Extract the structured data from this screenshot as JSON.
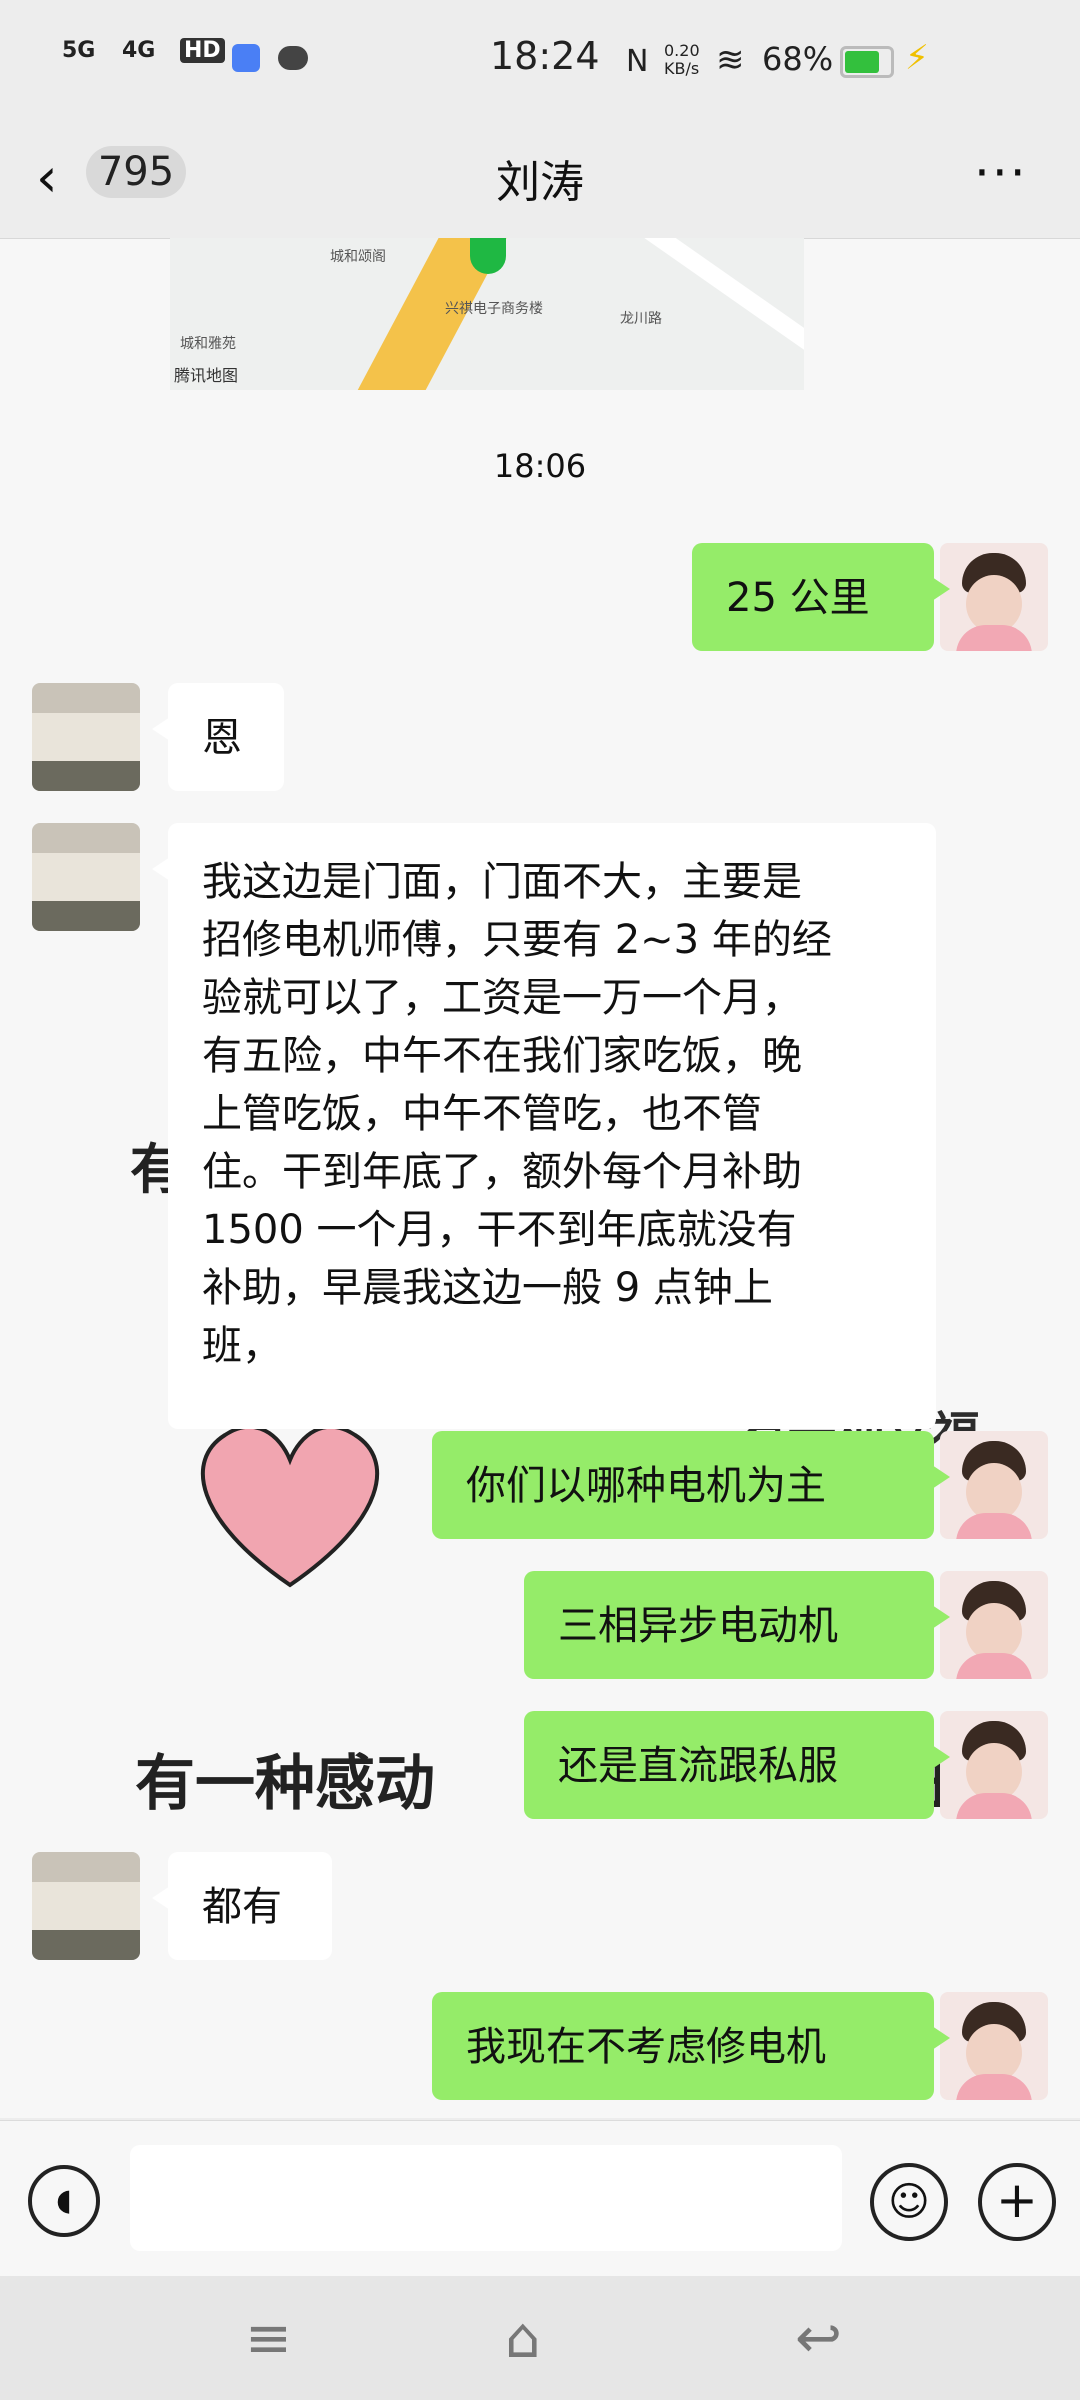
{
  "status_bar": {
    "signal_1": "5G",
    "signal_2": "4G",
    "hd": "HD",
    "time": "18:24",
    "net_speed": "0.20 KB/s",
    "battery_text": "68%"
  },
  "header": {
    "back_count": "795",
    "title": "刘涛",
    "more": "···"
  },
  "map": {
    "label_1": "城和颂阁",
    "label_2": "兴祺电子商务楼",
    "label_3": "龙川路",
    "label_4": "城和雅苑",
    "brand": "腾讯地图"
  },
  "timestamp": "18:06",
  "messages": [
    {
      "side": "me",
      "text": "25 公里"
    },
    {
      "side": "other",
      "text": "恩"
    },
    {
      "side": "other",
      "lines": [
        "我这边是门面，门面不大，主要是",
        "招修电机师傅，只要有 2~3 年的经",
        "验就可以了，工资是一万一个月，",
        "有五险，中午不在我们家吃饭，晚",
        "上管吃饭，中午不管吃，也不管",
        "住。干到年底了，额外每个月补助",
        "1500 一个月，干不到年底就没有",
        "补助，早晨我这边一般 9 点钟上",
        "班，"
      ]
    },
    {
      "side": "me",
      "text": "你们以哪种电机为主"
    },
    {
      "side": "me",
      "text": "三相异步电动机"
    },
    {
      "side": "me",
      "text": "还是直流跟私服"
    },
    {
      "side": "other",
      "text": "都有"
    },
    {
      "side": "me",
      "text": "我现在不考虑修电机"
    }
  ],
  "wallpaper": {
    "text_a": "有",
    "text_b": "有一种幸福",
    "text_c": "有一种感动",
    "text_d": "王"
  },
  "icons": {
    "voice": "voice-icon",
    "emoji": "emoji-icon",
    "plus": "plus-icon"
  }
}
